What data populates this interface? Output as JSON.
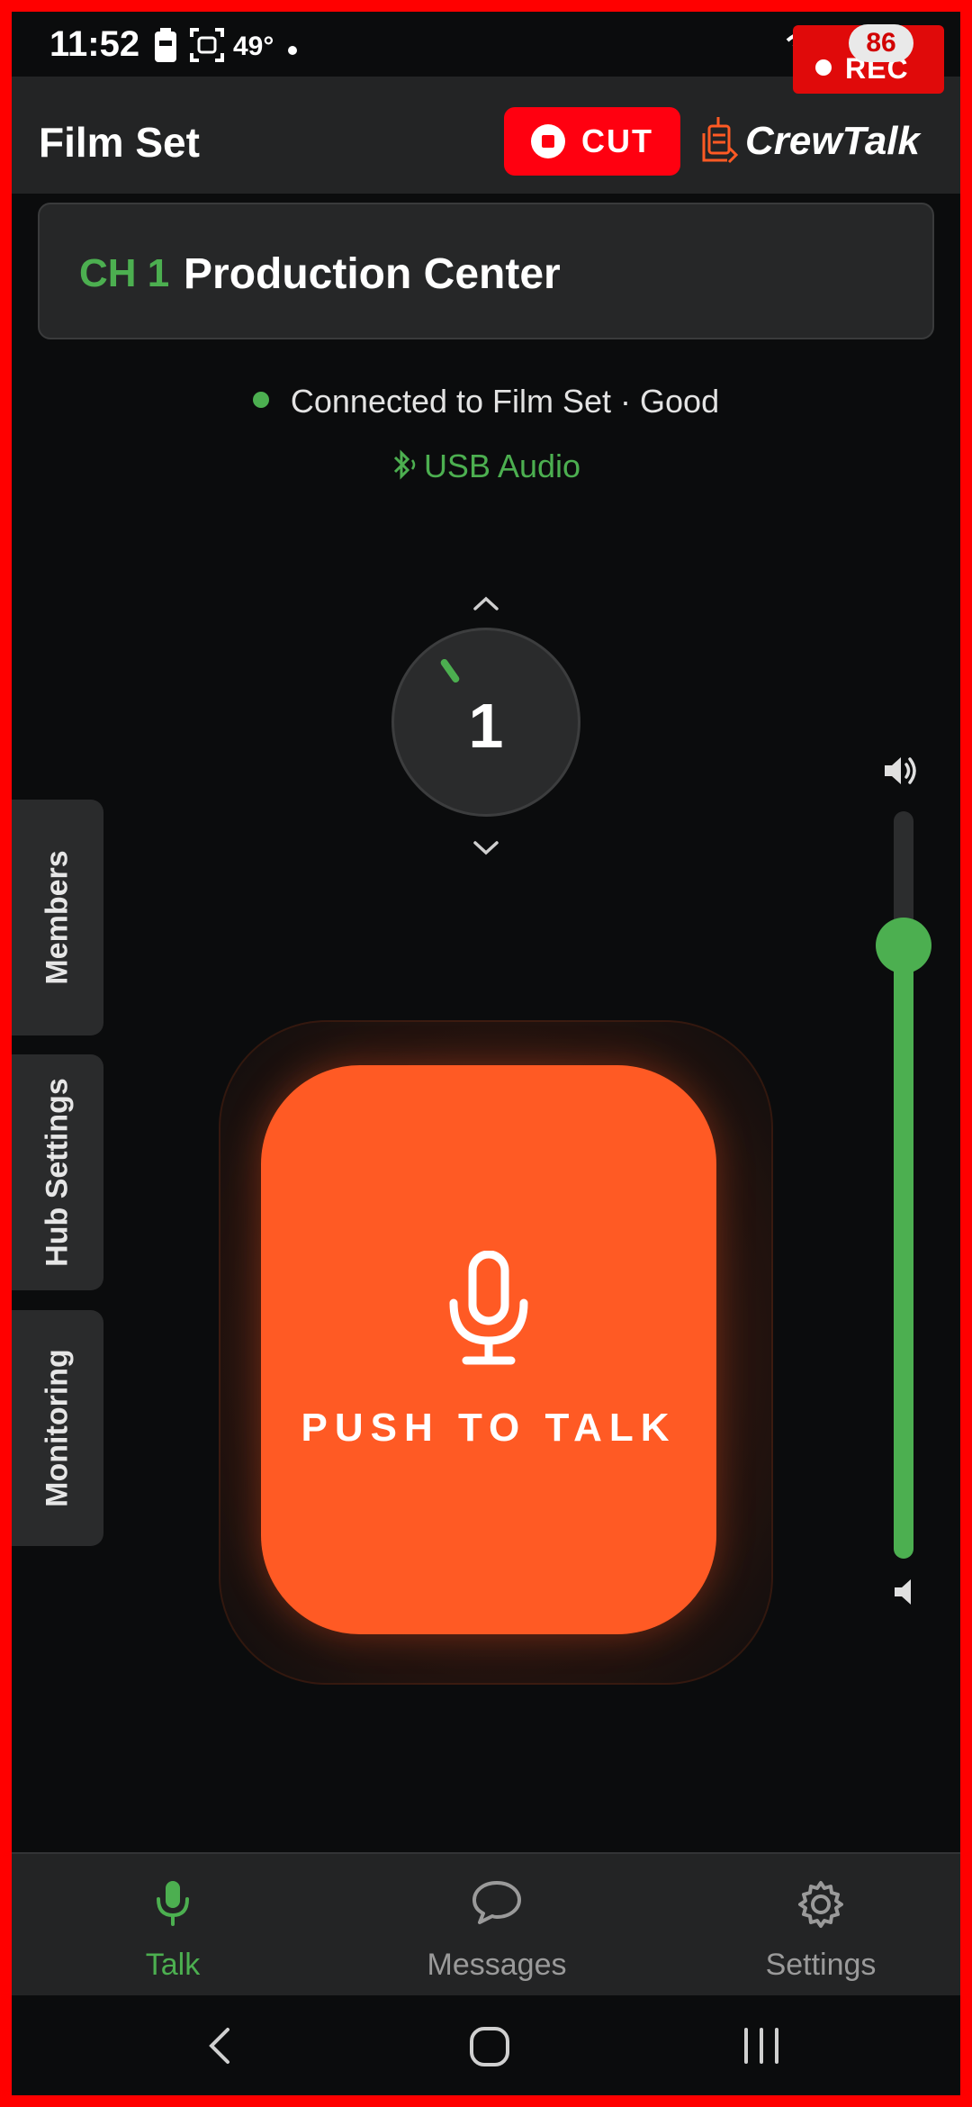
{
  "status_bar": {
    "time": "11:52",
    "temperature": "49°",
    "battery_level": "86",
    "battery_icon": "battery-icon",
    "screenshot_icon": "screenshot-icon",
    "wifi_icon": "wifi-icon",
    "signal_icon": "signal-icon"
  },
  "recording": {
    "label": "REC"
  },
  "header": {
    "title": "Film Set",
    "cut_label": "CUT",
    "brand": "CrewTalk",
    "accent_color": "#ff0010"
  },
  "channel": {
    "id": "CH 1",
    "name": "Production Center"
  },
  "connection": {
    "status_text": "Connected to Film Set · Good",
    "status_color": "#4caf50",
    "audio_route": "USB Audio"
  },
  "dial": {
    "value": "1"
  },
  "side_tabs": [
    {
      "label": "Members"
    },
    {
      "label": "Hub Settings"
    },
    {
      "label": "Monitoring"
    }
  ],
  "volume": {
    "level_fraction": 0.82
  },
  "ptt": {
    "label": "PUSH TO TALK",
    "color": "#ff5a24"
  },
  "bottom_nav": {
    "items": [
      {
        "label": "Talk",
        "icon": "mic-icon",
        "active": true
      },
      {
        "label": "Messages",
        "icon": "chat-bubble-icon",
        "active": false
      },
      {
        "label": "Settings",
        "icon": "gear-icon",
        "active": false
      }
    ],
    "active_color": "#4caf50",
    "inactive_color": "#9a9a9a"
  }
}
